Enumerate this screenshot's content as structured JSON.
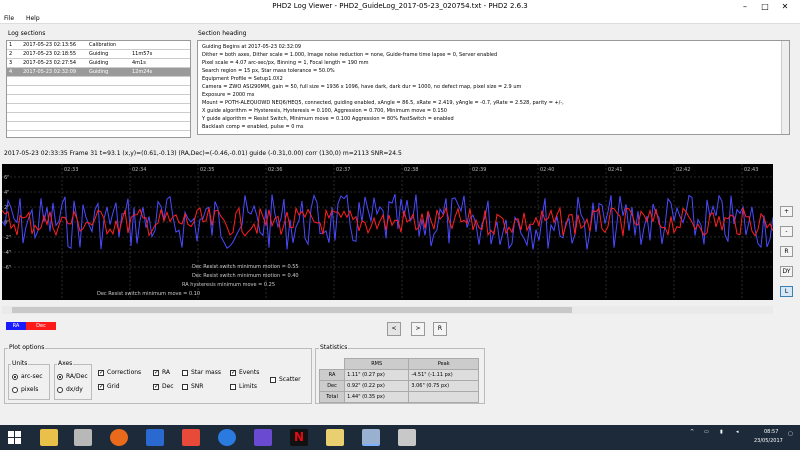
{
  "window": {
    "title": "PHD2 Log Viewer - PHD2_GuideLog_2017-05-23_020754.txt - PHD2 2.6.3",
    "minimize_glyph": "–",
    "maximize_glyph": "□",
    "close_glyph": "✕"
  },
  "menu": {
    "items": [
      "File",
      "Help"
    ]
  },
  "log_sections": {
    "label": "Log sections",
    "rows": [
      {
        "n": "1",
        "date": "2017-05-23 02:13:56",
        "type": "Calibration",
        "dur": ""
      },
      {
        "n": "2",
        "date": "2017-05-23 02:18:55",
        "type": "Guiding",
        "dur": "11m57s"
      },
      {
        "n": "3",
        "date": "2017-05-23 02:27:54",
        "type": "Guiding",
        "dur": "4m1s"
      },
      {
        "n": "4",
        "date": "2017-05-23 02:32:09",
        "type": "Guiding",
        "dur": "12m24s"
      }
    ]
  },
  "section_heading": {
    "label": "Section heading",
    "lines": [
      "Guiding Begins at 2017-05-23 02:32:09",
      "Dither = both axes, Dither scale = 1.000, Image noise reduction = none, Guide-frame time lapse = 0, Server enabled",
      "Pixel scale = 4.07 arc-sec/px, Binning = 1, Focal length = 190 mm",
      "Search region = 15 px, Star mass tolerance = 50.0%",
      "Equipment Profile = Setup1.0X2",
      "Camera = ZWO ASI290MM, gain = 50, full size = 1936 x 1096, have dark, dark dur = 1000, no defect map, pixel size = 2.9 um",
      "Exposure = 2000 ms",
      "Mount = POTH-ALEQUOWD NEQ6/HEQ5, connected, guiding enabled, xAngle = 86.5, xRate = 2.419, yAngle = -0.7, yRate = 2.528, parity = +/-,",
      "X guide algorithm = Hysteresis, Hysteresis = 0.100, Aggression = 0.700, Minimum move = 0.150",
      "Y guide algorithm = Resist Switch, Minimum move = 0.100 Aggression = 80% FastSwitch = enabled",
      "Backlash comp = enabled, pulse = 0 ms"
    ]
  },
  "info_line": "2017-05-23 02:33:35 Frame 31 t=93.1 (x,y)=(0.61,-0.13) (RA,Dec)=(-0.46,-0.01) guide (-0.31,0.00) corr (130,0) m=2113 SNR=24.5",
  "graph": {
    "time_ticks": [
      "02:33",
      "02:34",
      "02:35",
      "02:36",
      "02:37",
      "02:38",
      "02:39",
      "02:40",
      "02:41",
      "02:42",
      "02:43"
    ],
    "y_ticks": [
      "6\"",
      "4\"",
      "2\"",
      "0\"",
      "-2\"",
      "-4\"",
      "-6\""
    ],
    "annotations": [
      "Dec Resist switch minimum motion = 0.55",
      "Dec Resist switch minimum motion = 0.40",
      "RA hysteresis minimum move = 0.25",
      "Dec Resist switch minimum move = 0.10"
    ],
    "colors": {
      "ra": "#4a4aff",
      "dec": "#ff2020",
      "background": "#000000",
      "grid": "#555555"
    }
  },
  "side_buttons": [
    "+",
    "-",
    "R",
    "DY",
    "L"
  ],
  "legend": {
    "ra": "RA",
    "dec": "Dec"
  },
  "nav_buttons": [
    "<",
    ">",
    "R"
  ],
  "plot_options": {
    "label": "Plot options",
    "units_label": "Units",
    "units": [
      "arc-sec",
      "pixels"
    ],
    "axes_label": "Axes",
    "axes": [
      "RA/Dec",
      "dx/dy"
    ],
    "checks": {
      "corrections": "Corrections",
      "grid": "Grid",
      "ra": "RA",
      "dec": "Dec",
      "star_mass": "Star mass",
      "snr": "SNR",
      "events": "Events",
      "limits": "Limits",
      "scatter": "Scatter"
    }
  },
  "statistics": {
    "label": "Statistics",
    "headers": [
      "",
      "RMS",
      "Peak"
    ],
    "rows": [
      {
        "name": "RA",
        "rms": "1.11\" (0.27 px)",
        "peak": "-4.51\" (-1.11 px)"
      },
      {
        "name": "Dec",
        "rms": "0.92\" (0.22 px)",
        "peak": "3.06\" (0.75 px)"
      },
      {
        "name": "Total",
        "rms": "1.44\" (0.35 px)",
        "peak": ""
      }
    ]
  },
  "taskbar": {
    "time": "08:57",
    "date": "23/05/2017"
  }
}
